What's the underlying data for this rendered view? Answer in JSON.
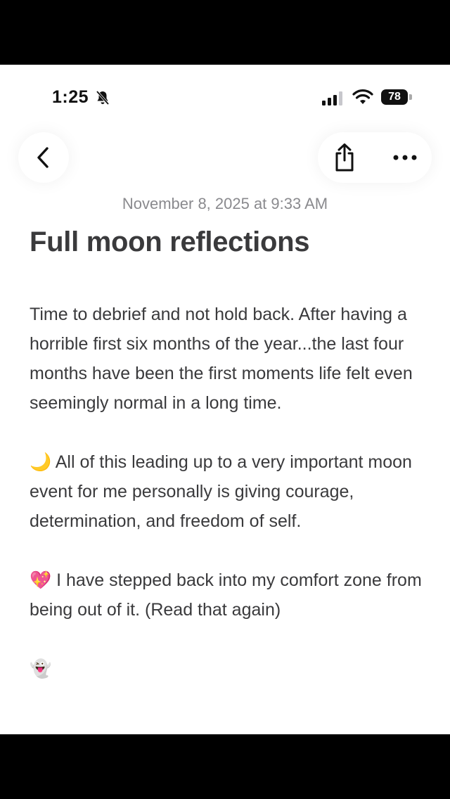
{
  "status_bar": {
    "time": "1:25",
    "battery": "78",
    "icons": [
      "bell-slash-icon",
      "cellular-signal-icon",
      "wifi-icon",
      "battery-icon"
    ]
  },
  "toolbar": {
    "back_icon": "chevron-left-icon",
    "share_icon": "share-icon",
    "more_icon": "ellipsis-icon"
  },
  "entry": {
    "date": "November 8, 2025 at 9:33 AM",
    "title": "Full moon reflections",
    "paragraphs": [
      {
        "emoji": "",
        "text": "Time to debrief and not hold back. After having a horrible first six months of the year...the last four months have been the first moments life felt even seemingly normal in a long time."
      },
      {
        "emoji": "🌙",
        "text": "All of this leading up to a very important moon event for me personally is giving courage, determination, and freedom of self."
      },
      {
        "emoji": "💖",
        "text": "I have stepped back into my comfort zone from being out of it. (Read that again)"
      },
      {
        "emoji": "👻",
        "text": ""
      }
    ]
  },
  "colors": {
    "text": "#3a3a3c",
    "muted": "#8a8a8e",
    "background": "#ffffff"
  }
}
